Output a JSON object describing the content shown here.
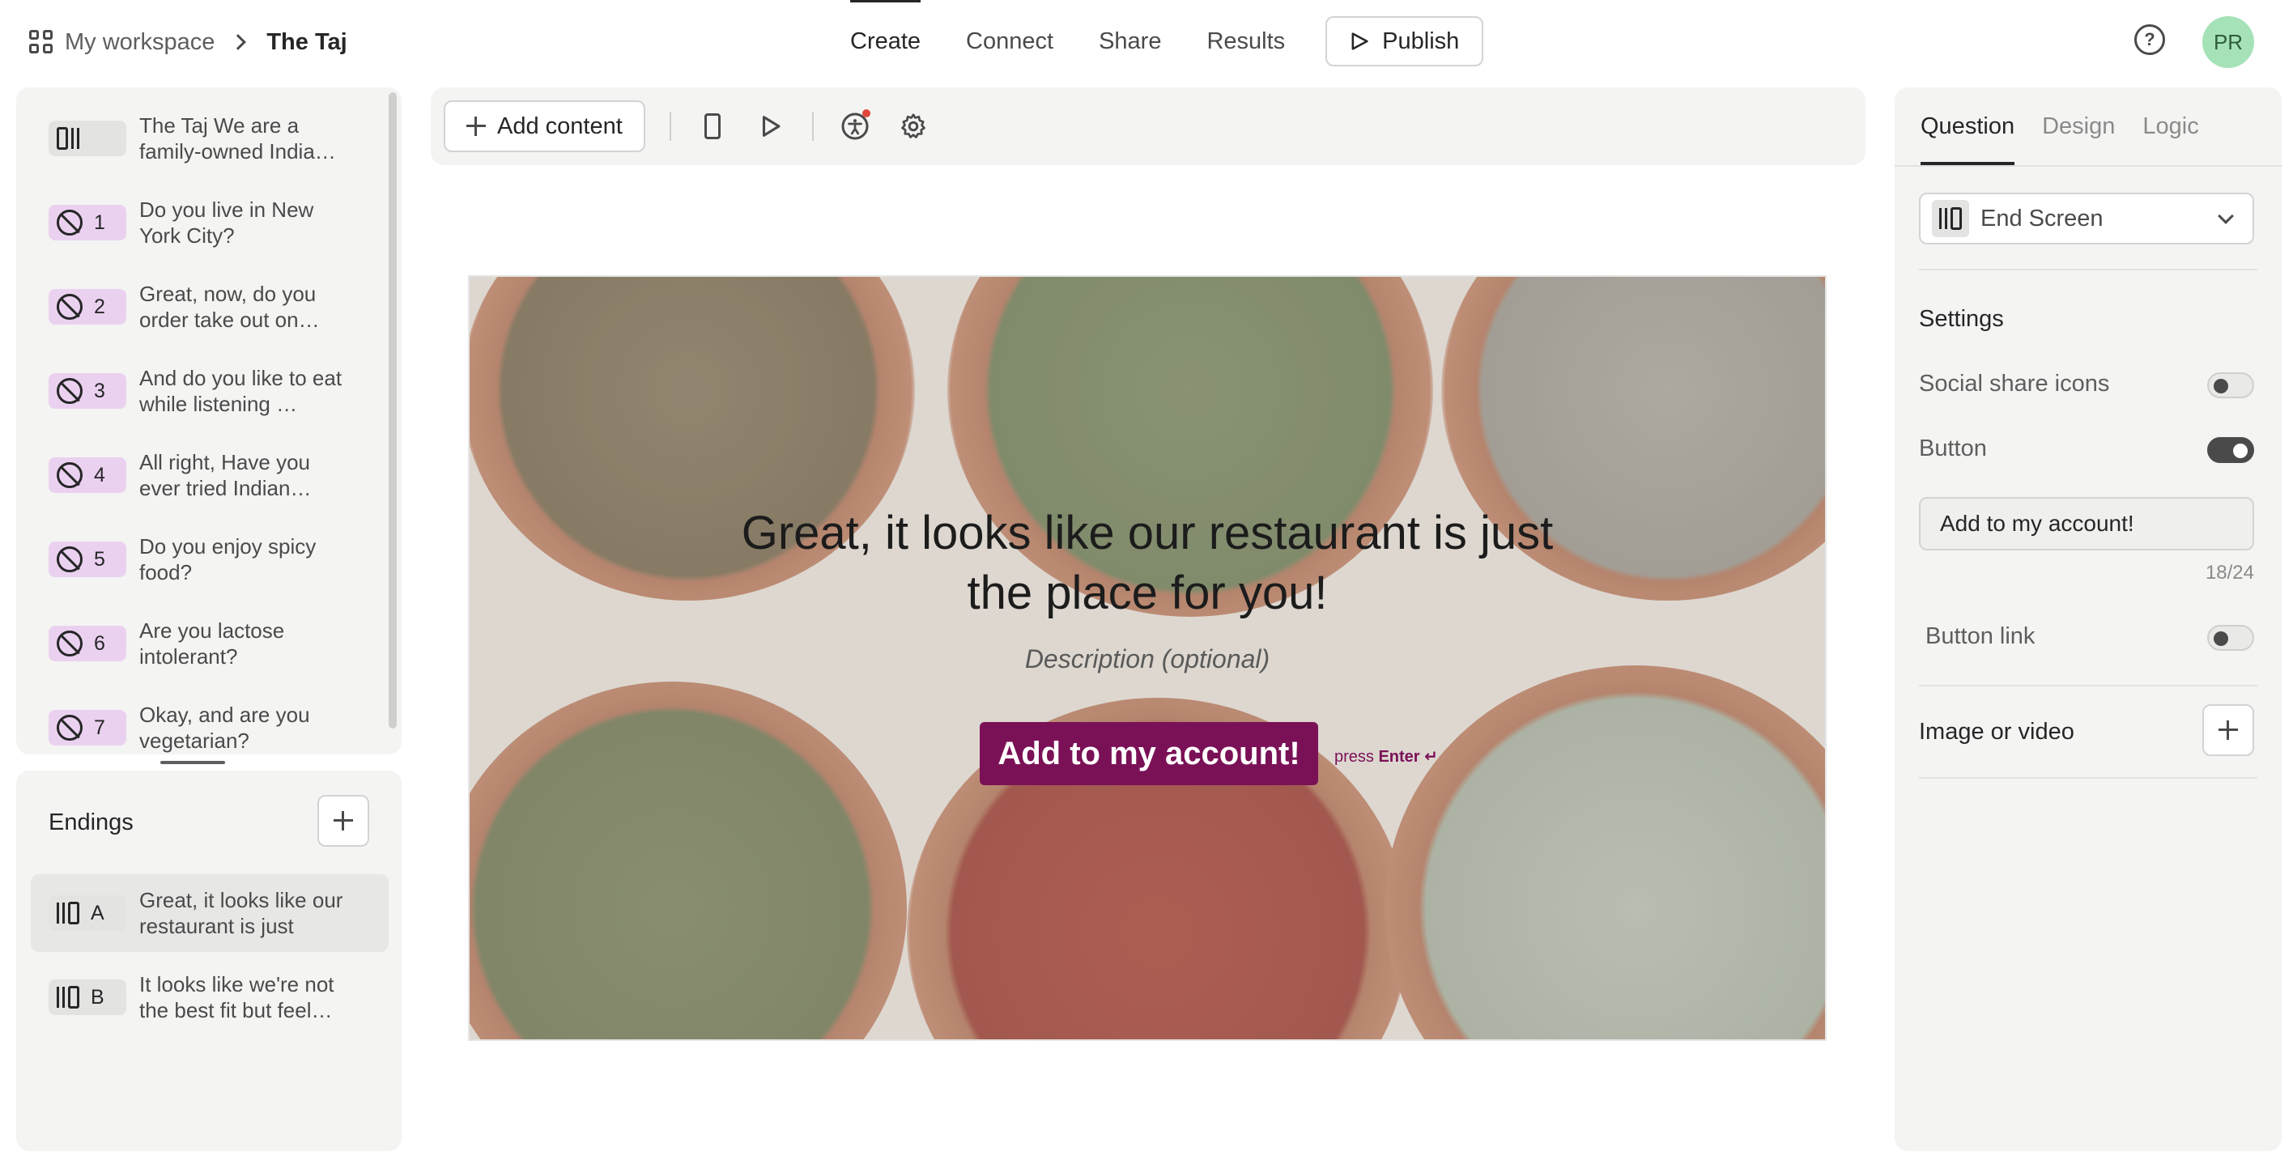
{
  "breadcrumb": {
    "workspace": "My workspace",
    "current": "The Taj"
  },
  "nav": {
    "tabs": [
      "Create",
      "Connect",
      "Share",
      "Results"
    ],
    "active": "Create",
    "publish_label": "Publish"
  },
  "user": {
    "initials": "PR",
    "avatar_color": "#a6e2b8"
  },
  "questions": [
    {
      "num": "",
      "text": "The Taj We are a family-owned India…",
      "type": "welcome"
    },
    {
      "num": "1",
      "text": "Do you live in New York City?",
      "type": "question"
    },
    {
      "num": "2",
      "text": "Great, now, do you order take out on…",
      "type": "question"
    },
    {
      "num": "3",
      "text": "And do you like to eat while listening …",
      "type": "question"
    },
    {
      "num": "4",
      "text": "All right, Have you ever tried Indian…",
      "type": "question"
    },
    {
      "num": "5",
      "text": "Do you enjoy spicy food?",
      "type": "question"
    },
    {
      "num": "6",
      "text": "Are you lactose intolerant?",
      "type": "question"
    },
    {
      "num": "7",
      "text": "Okay, and are you vegetarian?",
      "type": "question"
    }
  ],
  "endings": {
    "title": "Endings",
    "items": [
      {
        "letter": "A",
        "text": "Great, it looks like our restaurant is just the…",
        "selected": true
      },
      {
        "letter": "B",
        "text": "It looks like we're not the best fit but feel…",
        "selected": false
      }
    ]
  },
  "toolbar": {
    "add_content_label": "Add content"
  },
  "canvas": {
    "headline": "Great, it looks like our restaurant is just the place for you!",
    "description_placeholder": "Description (optional)",
    "cta_label": "Add to my account!",
    "press_prefix": "press",
    "press_key": "Enter ↵",
    "cta_color": "#7a1157"
  },
  "right_panel": {
    "tabs": [
      "Question",
      "Design",
      "Logic"
    ],
    "active_tab": "Question",
    "type_label": "End Screen",
    "settings_title": "Settings",
    "social_share_label": "Social share icons",
    "social_share_on": false,
    "button_label": "Button",
    "button_on": true,
    "button_text_value": "Add to my account!",
    "char_count": "18/24",
    "button_link_label": "Button link",
    "button_link_on": false,
    "image_video_label": "Image or video"
  }
}
